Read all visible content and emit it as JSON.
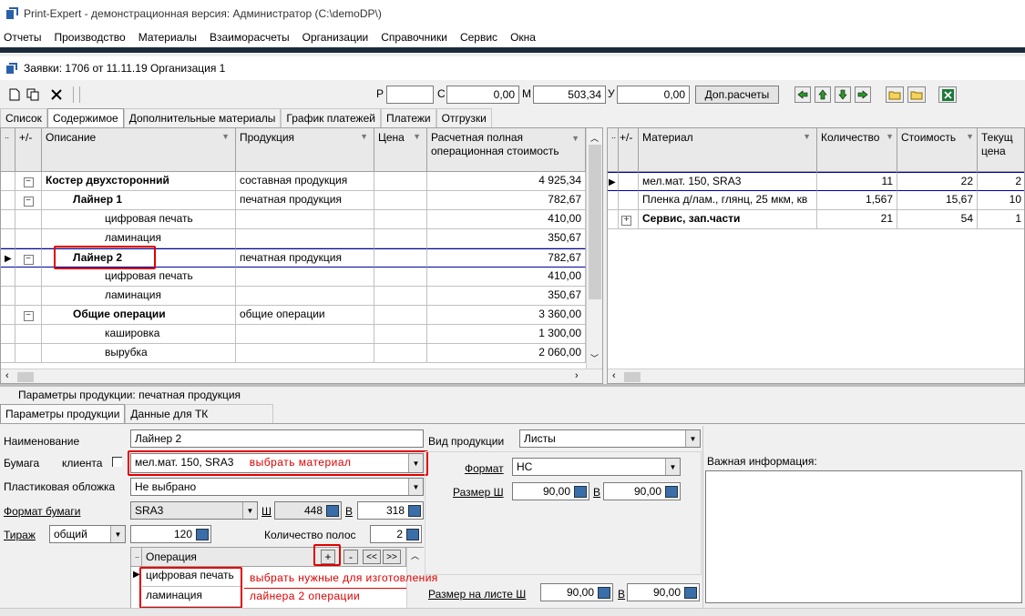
{
  "app": {
    "title": "Print-Expert - демонстрационная версия: Администратор (C:\\demoDP\\)"
  },
  "menu": [
    "Отчеты",
    "Производство",
    "Материалы",
    "Взаиморасчеты",
    "Организации",
    "Справочники",
    "Сервис",
    "Окна"
  ],
  "document": {
    "title": "Заявки: 1706 от 11.11.19  Организация 1"
  },
  "toolbar": {
    "r_label": "Р",
    "r_value": "",
    "s_label": "С",
    "s_value": "0,00",
    "m_label": "М",
    "m_value": "503,34",
    "u_label": "У",
    "u_value": "0,00",
    "extra_button": "Доп.расчеты"
  },
  "tabs": [
    "Список",
    "Содержимое",
    "Дополнительные материалы",
    "График платежей",
    "Платежи",
    "Отгрузки"
  ],
  "left_grid": {
    "headers": {
      "pm": "+/-",
      "desc": "Описание",
      "product": "Продукция",
      "price": "Цена",
      "cost": "Расчетная полная операционная стоимость"
    },
    "rows": [
      {
        "desc": "Костер двухсторонний",
        "product": "составная продукция",
        "cost": "4 925,34"
      },
      {
        "desc": "Лайнер 1",
        "product": "печатная продукция",
        "cost": "782,67"
      },
      {
        "desc": "цифровая печать",
        "product": "",
        "cost": "410,00"
      },
      {
        "desc": "ламинация",
        "product": "",
        "cost": "350,67"
      },
      {
        "desc": "Лайнер 2",
        "product": "печатная продукция",
        "cost": "782,67"
      },
      {
        "desc": "цифровая печать",
        "product": "",
        "cost": "410,00"
      },
      {
        "desc": "ламинация",
        "product": "",
        "cost": "350,67"
      },
      {
        "desc": "Общие операции",
        "product": "общие операции",
        "cost": "3 360,00"
      },
      {
        "desc": "кашировка",
        "product": "",
        "cost": "1 300,00"
      },
      {
        "desc": "вырубка",
        "product": "",
        "cost": "2 060,00"
      }
    ]
  },
  "right_grid": {
    "headers": {
      "pm": "+/-",
      "material": "Материал",
      "qty": "Количество",
      "cost": "Стоимость",
      "current": "Текущ цена"
    },
    "rows": [
      {
        "material": "мел.мат. 150, SRA3",
        "qty": "11",
        "cost": "22",
        "current": "2"
      },
      {
        "material": "Пленка д/лам., глянц, 25 мкм, кв",
        "qty": "1,567",
        "cost": "15,67",
        "current": "10"
      },
      {
        "material": "Сервис, зап.части",
        "qty": "21",
        "cost": "54",
        "current": "1"
      }
    ]
  },
  "params": {
    "header": "Параметры продукции: печатная продукция",
    "tabs": [
      "Параметры продукции",
      "Данные для ТК"
    ],
    "name_label": "Наименование",
    "name_value": "Лайнер 2",
    "paper_label": "Бумага",
    "client_label": "клиента",
    "paper_value": "мел.мат. 150, SRA3",
    "paper_note": "выбрать материал",
    "cover_label": "Пластиковая обложка",
    "cover_value": "Не выбрано",
    "format_label": "Формат бумаги",
    "format_value": "SRA3",
    "w_label": "Ш",
    "w_value": "448",
    "h_label": "В",
    "h_value": "318",
    "tirazh_label": "Тираж",
    "tirazh_type": "общий",
    "tirazh_value": "120",
    "pages_label": "Количество полос",
    "pages_value": "2",
    "op_header": "Операция",
    "op_plus": "+",
    "op_minus": "-",
    "op_first": "<<",
    "op_last": ">>",
    "ops": [
      "цифровая печать",
      "ламинация"
    ],
    "ops_note1": "выбрать нужные для изготовления",
    "ops_note2": "лайнера 2 операции",
    "kind_label": "Вид продукции",
    "kind_value": "Листы",
    "fmt_label": "Формат",
    "fmt_value": "НС",
    "size_label": "Размер Ш",
    "size_w": "90,00",
    "size_b_label": "В",
    "size_h": "90,00",
    "sheet_label": "Размер на листе Ш",
    "sheet_w": "90,00",
    "sheet_b_label": "В",
    "sheet_h": "90,00",
    "info_label": "Важная информация:"
  }
}
